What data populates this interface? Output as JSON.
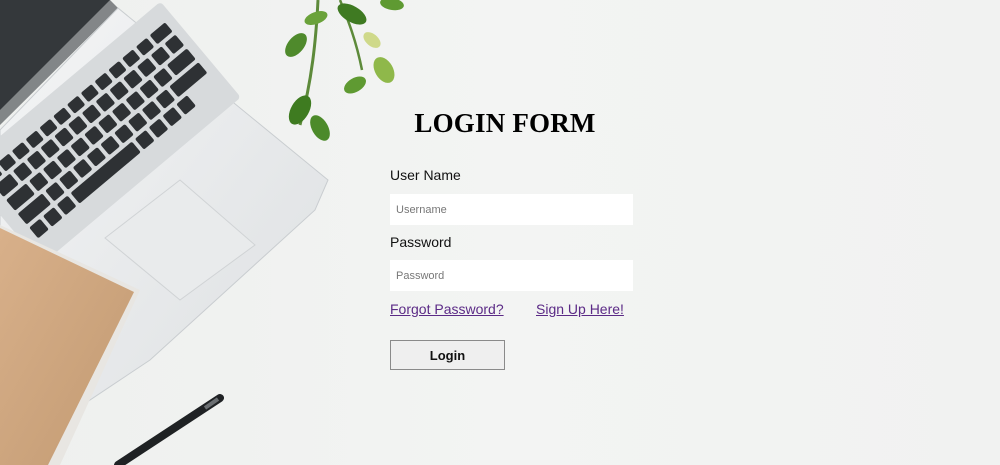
{
  "form": {
    "title": "LOGIN FORM",
    "username_label": "User Name",
    "username_placeholder": "Username",
    "username_value": "",
    "password_label": "Password",
    "password_placeholder": "Password",
    "password_value": "",
    "forgot_link": "Forgot Password?",
    "signup_link": "Sign Up Here!",
    "login_button": "Login"
  },
  "background": {
    "description_icon_names": [
      "laptop-icon",
      "notebook-icon",
      "pen-icon",
      "plant-icon"
    ]
  },
  "colors": {
    "link": "#5b2a86",
    "page_background": "#f1f2f1",
    "button_background": "#efefef"
  }
}
